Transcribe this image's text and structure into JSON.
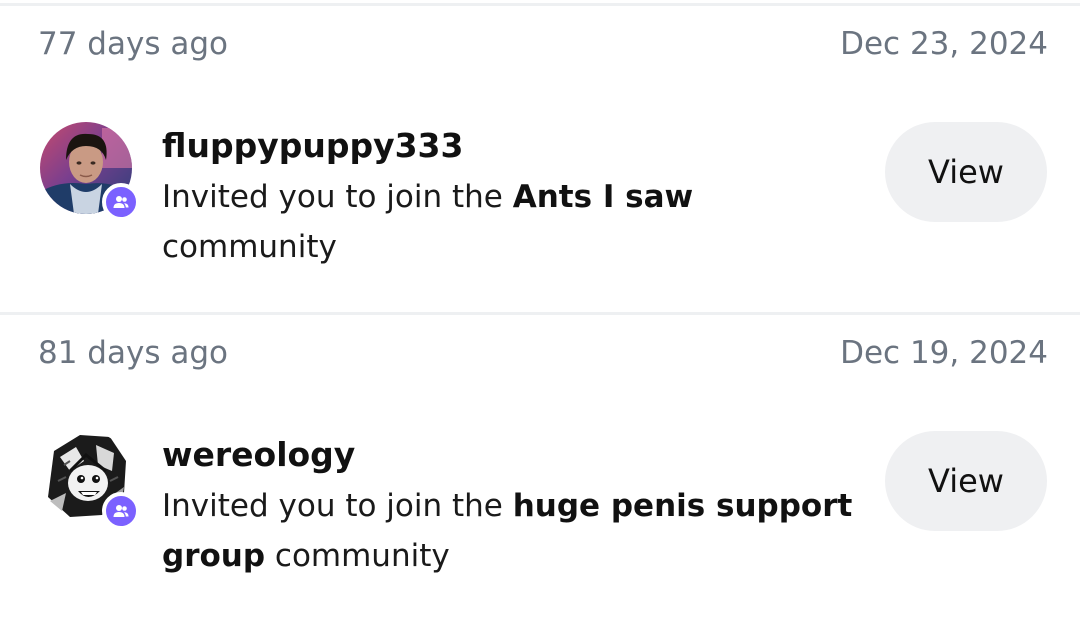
{
  "notifications": [
    {
      "relative_time": "77 days ago",
      "date": "Dec 23, 2024",
      "username": "fluppypuppy333",
      "message_prefix": "Invited you to join the ",
      "community_name": "Ants I saw",
      "message_suffix": " community",
      "view_label": "View",
      "badge_color": "#7b61ff",
      "avatar_icon": "profile-photo"
    },
    {
      "relative_time": "81 days ago",
      "date": "Dec 19, 2024",
      "username": "wereology",
      "message_prefix": "Invited you to join the ",
      "community_name": "huge penis support group",
      "message_suffix": " community",
      "view_label": "View",
      "badge_color": "#7b61ff",
      "avatar_icon": "cartoon-sketch-avatar"
    }
  ]
}
